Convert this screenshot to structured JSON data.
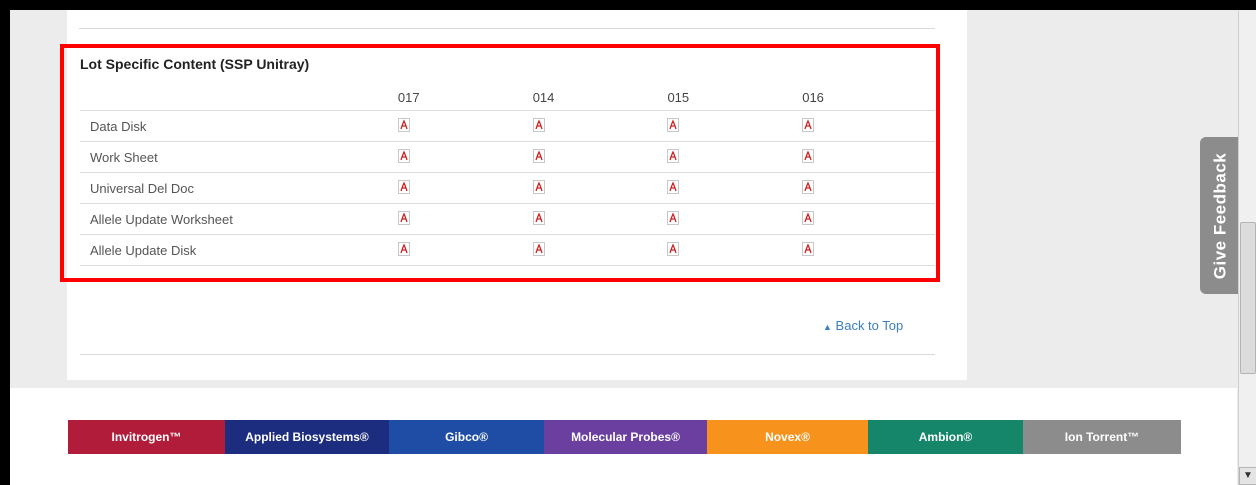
{
  "section": {
    "title": "Lot Specific Content (SSP Unitray)",
    "columns": [
      "017",
      "014",
      "015",
      "016"
    ],
    "rows": [
      {
        "label": "Data Disk"
      },
      {
        "label": "Work Sheet"
      },
      {
        "label": "Universal Del Doc"
      },
      {
        "label": "Allele Update Worksheet"
      },
      {
        "label": "Allele Update Disk"
      }
    ]
  },
  "back_to_top": "Back to Top",
  "feedback": "Give Feedback",
  "brands": [
    {
      "label": "Invitrogen™",
      "color": "#b01c3a"
    },
    {
      "label": "Applied Biosystems®",
      "color": "#1c2c7f"
    },
    {
      "label": "Gibco®",
      "color": "#1f4da6"
    },
    {
      "label": "Molecular Probes®",
      "color": "#6a3fa0"
    },
    {
      "label": "Novex®",
      "color": "#f7931d"
    },
    {
      "label": "Ambion®",
      "color": "#15866a"
    },
    {
      "label": "Ion Torrent™",
      "color": "#8c8c8c"
    }
  ],
  "colors": {
    "highlight": "#ff0000",
    "link": "#3a7fc1",
    "pdf": "#cc1f1f"
  },
  "icons": {
    "pdf": "pdf-icon",
    "back_to_top": "double-chevron-up-icon",
    "scroll_down": "chevron-down-icon"
  }
}
